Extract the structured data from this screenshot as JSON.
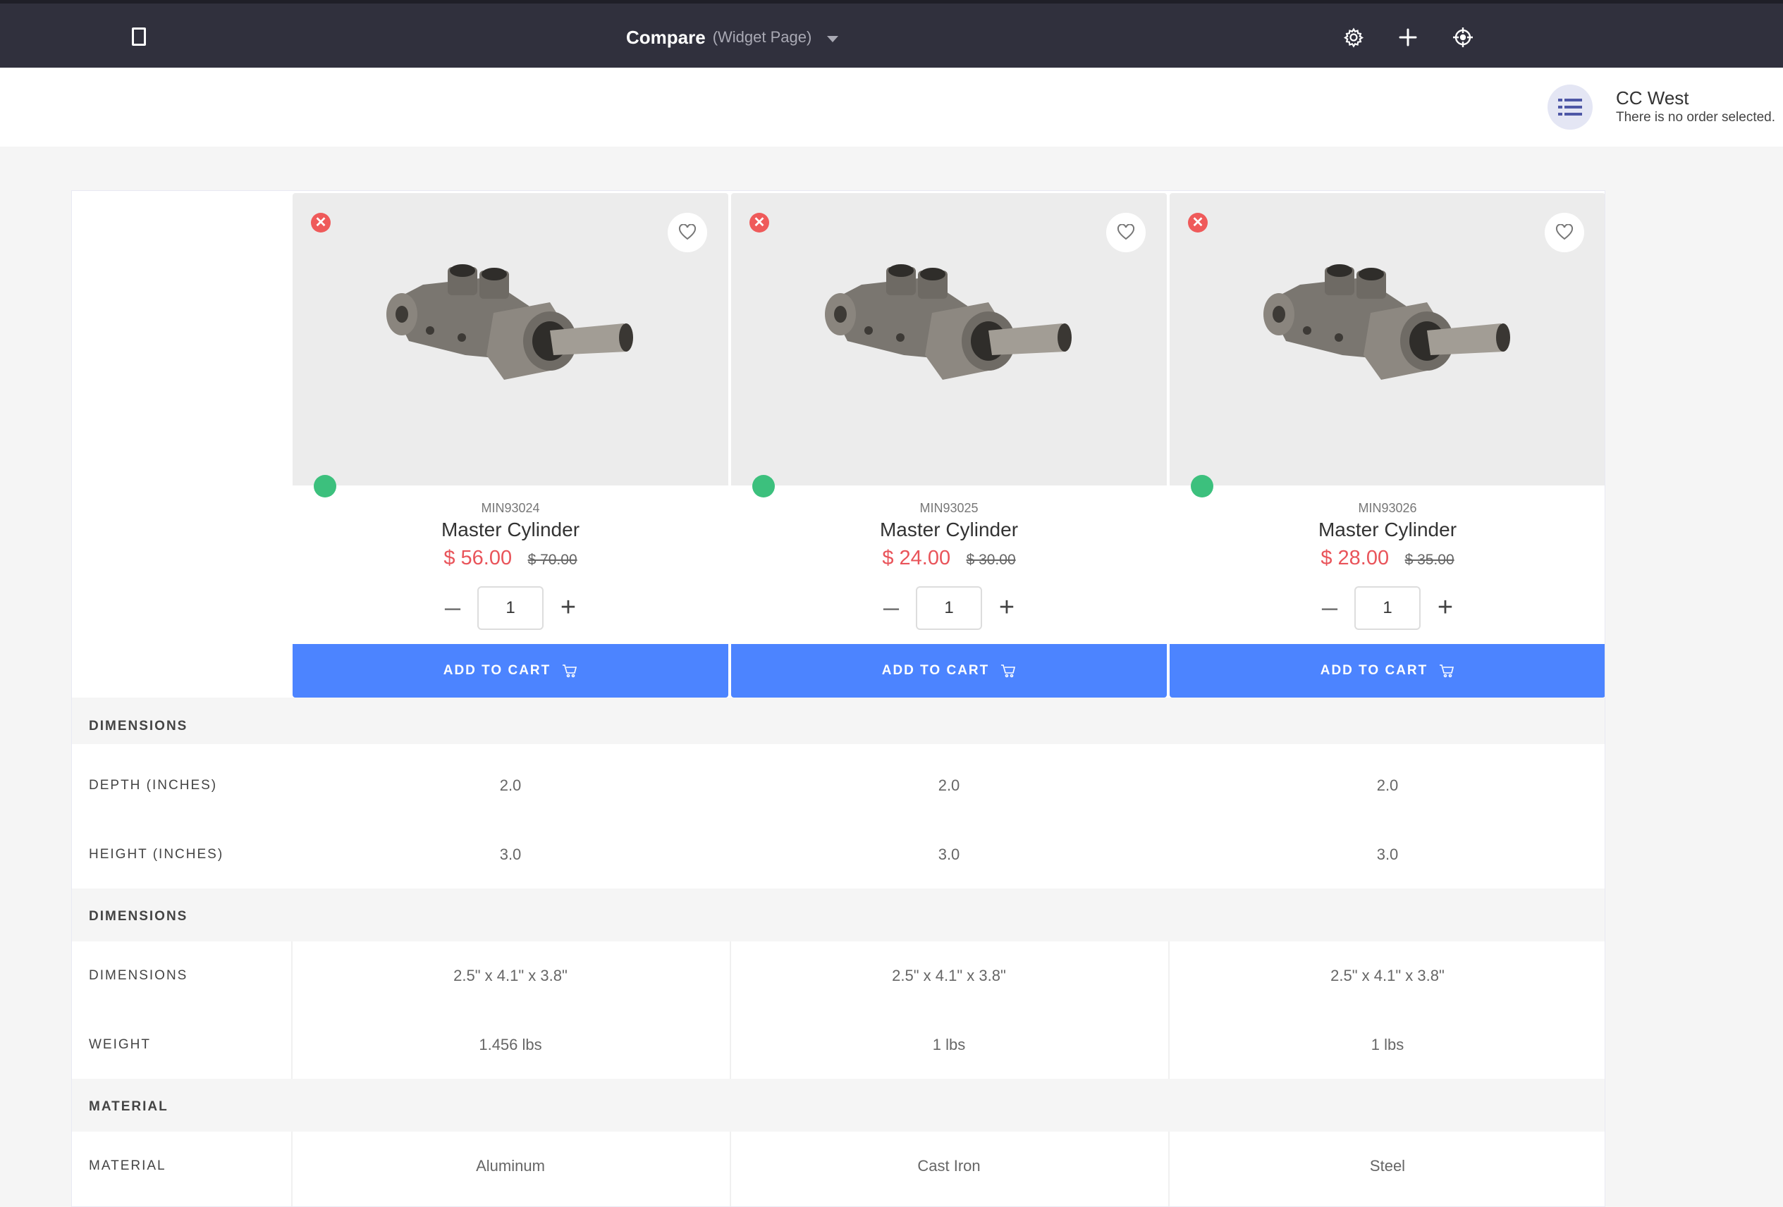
{
  "topbar": {
    "title": "Compare",
    "subtitle": "(Widget Page)",
    "icons": [
      "page-icon",
      "gear-icon",
      "plus-icon",
      "target-icon"
    ]
  },
  "account": {
    "name": "CC West",
    "status": "There is no order selected.",
    "icon": "list-icon"
  },
  "products": [
    {
      "sku": "MIN93024",
      "name": "Master Cylinder",
      "price": "$ 56.00",
      "old_price": "$ 70.00",
      "qty": "1",
      "add_label": "ADD TO CART"
    },
    {
      "sku": "MIN93025",
      "name": "Master Cylinder",
      "price": "$ 24.00",
      "old_price": "$ 30.00",
      "qty": "1",
      "add_label": "ADD TO CART"
    },
    {
      "sku": "MIN93026",
      "name": "Master Cylinder",
      "price": "$ 28.00",
      "old_price": "$ 35.00",
      "qty": "1",
      "add_label": "ADD TO CART"
    }
  ],
  "specs": [
    {
      "section": "DIMENSIONS",
      "rows": [
        {
          "label": "DEPTH (INCHES)",
          "values": [
            "2.0",
            "2.0",
            "2.0"
          ]
        },
        {
          "label": "HEIGHT (INCHES)",
          "values": [
            "3.0",
            "3.0",
            "3.0"
          ]
        }
      ]
    },
    {
      "section": "DIMENSIONS",
      "rows": [
        {
          "label": "DIMENSIONS",
          "values": [
            "2.5\" x 4.1\" x 3.8\"",
            "2.5\" x 4.1\" x 3.8\"",
            "2.5\" x 4.1\" x 3.8\""
          ]
        },
        {
          "label": "WEIGHT",
          "values": [
            "1.456 lbs",
            "1 lbs",
            "1 lbs"
          ]
        }
      ]
    },
    {
      "section": "MATERIAL",
      "rows": [
        {
          "label": "MATERIAL",
          "values": [
            "Aluminum",
            "Cast Iron",
            "Steel"
          ]
        }
      ]
    }
  ],
  "colors": {
    "topbar": "#30303d",
    "accent": "#4c84ff",
    "price": "#e9545a",
    "remove": "#ef5a5a",
    "in_stock": "#3cc07d"
  }
}
